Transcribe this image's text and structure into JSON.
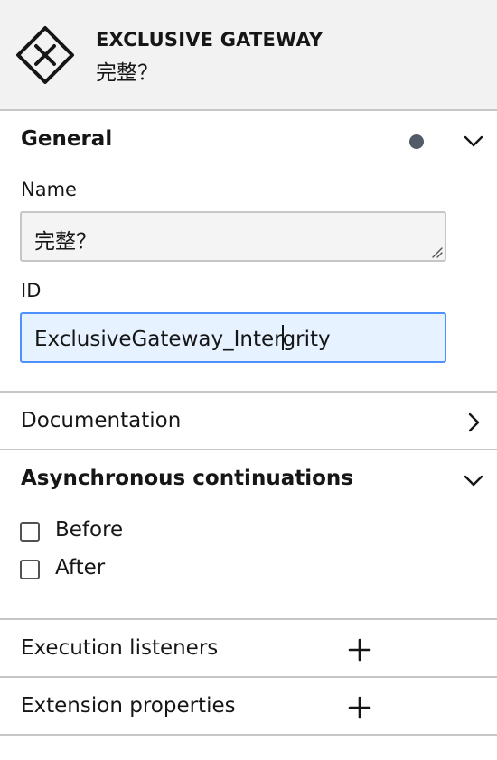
{
  "header": {
    "element_type": "EXCLUSIVE GATEWAY",
    "element_name": "完整？",
    "icon": "exclusive-gateway-icon"
  },
  "general": {
    "title": "General",
    "expanded": true,
    "has_changes": true,
    "name_label": "Name",
    "name_value": "完整？",
    "id_label": "ID",
    "id_value_before_caret": "ExclusiveGateway_Inter",
    "id_value_after_caret": "grity"
  },
  "documentation": {
    "title": "Documentation",
    "expanded": false
  },
  "async": {
    "title": "Asynchronous continuations",
    "expanded": true,
    "before_label": "Before",
    "before_checked": false,
    "after_label": "After",
    "after_checked": false
  },
  "execution_listeners": {
    "title": "Execution listeners",
    "icon": "plus-icon"
  },
  "extension_properties": {
    "title": "Extension properties",
    "icon": "plus-icon"
  },
  "colors": {
    "header_bg": "#f2f2f2",
    "border": "#c6c6c6",
    "focus_border": "#4d90fe",
    "focus_bg": "#e6f2ff",
    "dot": "#525c69"
  }
}
